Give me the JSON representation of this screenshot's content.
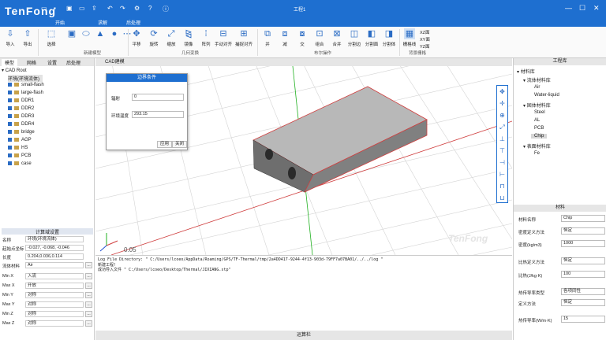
{
  "titlebar": {
    "logo_text": "TenFong",
    "title": "工程1",
    "minimize": "—",
    "maximize": "☐",
    "close": "✕"
  },
  "ribbon_tabs": [
    "开始",
    "求解",
    "后处理"
  ],
  "ribbon": {
    "import": "导入",
    "export": "导出",
    "select": "选择",
    "new_model": "新建模型",
    "translate": "平移",
    "rotate": "旋转",
    "scale": "缩放",
    "mirror": "镜像",
    "array": "阵列",
    "manual_align": "手动对齐",
    "snap_align": "捕捉对齐",
    "geo_transform": "几何变换",
    "union": "并",
    "subtract": "减",
    "intersect": "交",
    "combine": "组合",
    "merge": "合并",
    "split_edge": "分割边",
    "split_face": "分割面",
    "split_body": "分割体",
    "boolean_ops": "布尔操作",
    "grid": "栅格线",
    "xz_plane": "XZ面",
    "xy_plane": "XY面",
    "yz_plane": "YZ面",
    "background_grid": "背景栅格"
  },
  "left_tabs": [
    "模型",
    "网格",
    "设置",
    "后处理"
  ],
  "tree": {
    "root": "CAD Root",
    "env": "环境(环境流体)",
    "items": [
      "small-flash",
      "large-flash",
      "DDR1",
      "DDR2",
      "DDR3",
      "DDR4",
      "bridge",
      "AGP",
      "HS",
      "PCB",
      "case"
    ]
  },
  "domain_settings": {
    "header": "计算域设置",
    "name_label": "名称",
    "name_value": "环境(环境流体)",
    "origin_label": "起始点坐标",
    "origin_value": "-0.027, -0.068, -0.046",
    "length_label": "长度",
    "length_value": "0.204,0.036,0.114",
    "fluid_label": "流体材料",
    "fluid_value": "Air",
    "rows": [
      {
        "label": "Min X",
        "value": "入流"
      },
      {
        "label": "Max X",
        "value": "开放"
      },
      {
        "label": "Min Y",
        "value": "对称"
      },
      {
        "label": "Max Y",
        "value": "对称"
      },
      {
        "label": "Min Z",
        "value": "对称"
      },
      {
        "label": "Max Z",
        "value": "对称"
      }
    ],
    "more": "..."
  },
  "canvas": {
    "tab": "CAD建模",
    "axis_value": "0.05",
    "watermark": "TenFong"
  },
  "dialog": {
    "title": "边界条件",
    "radiation_label": "辐射",
    "radiation_value": "0",
    "ambient_label": "环境温度",
    "ambient_value": "293.15",
    "apply": "应用",
    "close": "关闭"
  },
  "console": {
    "lines": [
      "Log File Directory: \" C:/Users/lcoeo/AppData/Roaming/GPS/TF-Thermal/tmp/2a4DD417-9244-4f13-903d-79FF7a07BA01/../../log \"",
      "新建工程!",
      "成功导入文件 \" C:/Users/lcoeo/Desktop/Thermal/JIXIANG.stp\""
    ]
  },
  "statusbar": "运算栏",
  "right_panel": {
    "header": "工程库",
    "lib_root": "材料库",
    "fluid_group": "流体材料库",
    "fluids": [
      "Air",
      "Water-liquid"
    ],
    "solid_group": "固体材料库",
    "solids": [
      "Steel",
      "AL",
      "PCB",
      "Chip"
    ],
    "surface_group": "表面材料库",
    "surfaces": [
      "Fe"
    ]
  },
  "material": {
    "header": "材料",
    "rows": [
      {
        "label": "材料名称",
        "value": "Chip"
      },
      {
        "label": "密度定义方法",
        "value": "恒定"
      },
      {
        "label": "密度(kg/m3)",
        "value": "1000"
      },
      {
        "label": "比热定义方法",
        "value": "恒定"
      },
      {
        "label": "比热(J/kg·K)",
        "value": "100"
      },
      {
        "label": "热传导率类型",
        "value": "各项同性"
      },
      {
        "label": "定义方法",
        "value": "恒定"
      },
      {
        "label": "热传导率(W/m·K)",
        "value": "15"
      }
    ]
  }
}
